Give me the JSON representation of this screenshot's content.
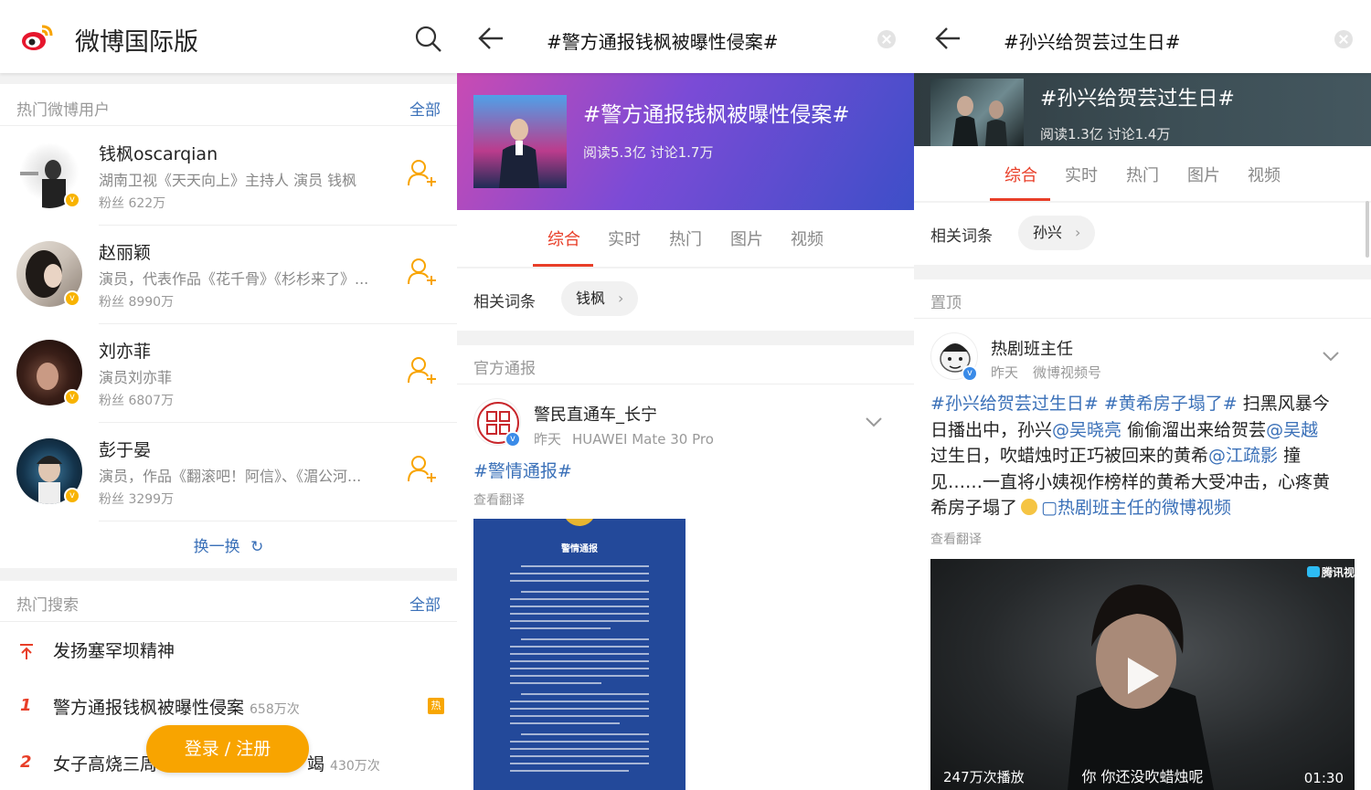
{
  "panel1": {
    "app_title": "微博国际版",
    "hot_users": {
      "label": "热门微博用户",
      "all": "全部",
      "users": [
        {
          "name": "钱枫oscarqian",
          "desc": "湖南卫视《天天向上》主持人 演员 钱枫",
          "fans": "粉丝 622万"
        },
        {
          "name": "赵丽颖",
          "desc": "演员，代表作品《花千骨》《杉杉来了》...",
          "fans": "粉丝 8990万"
        },
        {
          "name": "刘亦菲",
          "desc": "演员刘亦菲",
          "fans": "粉丝 6807万"
        },
        {
          "name": "彭于晏",
          "desc": "演员，作品《翻滚吧！阿信》、《湄公河...",
          "fans": "粉丝 3299万"
        }
      ],
      "refresh": "换一换"
    },
    "hot_search": {
      "label": "热门搜索",
      "all": "全部",
      "items": [
        {
          "rank": "",
          "text": "发扬塞罕坝精神",
          "count": "",
          "tag": ""
        },
        {
          "rank": "1",
          "text": "警方通报钱枫被曝性侵案",
          "count": "658万次",
          "tag": "热"
        },
        {
          "rank": "2",
          "text": "女子高烧三周",
          "count": "430万次",
          "tag": "",
          "tail": "竭"
        }
      ]
    },
    "login_button": "登录 / 注册"
  },
  "panel2": {
    "search_title": "#警方通报钱枫被曝性侵案#",
    "banner": {
      "title": "#警方通报钱枫被曝性侵案#",
      "meta": "阅读5.3亿  讨论1.7万"
    },
    "tabs": [
      "综合",
      "实时",
      "热门",
      "图片",
      "视频"
    ],
    "related": {
      "label": "相关词条",
      "chip": "钱枫"
    },
    "section_label": "官方通报",
    "post": {
      "name": "警民直通车_长宁",
      "time": "昨天",
      "device": "HUAWEI Mate 30 Pro",
      "hashtag": "#警情通报#",
      "translate": "查看翻译",
      "notice_title": "警情通报"
    }
  },
  "panel3": {
    "search_title": "#孙兴给贺芸过生日#",
    "banner": {
      "title": "#孙兴给贺芸过生日#",
      "meta": "阅读1.3亿  讨论1.4万"
    },
    "tabs": [
      "综合",
      "实时",
      "热门",
      "图片",
      "视频"
    ],
    "related": {
      "label": "相关词条",
      "chip": "孙兴"
    },
    "section_label": "置顶",
    "post": {
      "name": "热剧班主任",
      "time": "昨天",
      "source": "微博视频号",
      "tag1": "#孙兴给贺芸过生日#",
      "tag2": "#黄希房子塌了#",
      "t1": " 扫黑风暴今",
      "t2": "日播出中，孙兴",
      "m1": "@吴晓亮",
      "t3": " 偷偷溜出来给贺芸",
      "m2": "@吴越",
      "t4": "过生日，吹蜡烛时正巧被回来的黄希",
      "m3": "@江疏影",
      "t5": " 撞",
      "t6": "见……一直将小姨视作榜样的黄希大受冲击，心疼黄",
      "t7": "希房子塌了",
      "video_link": "热剧班主任的微博视频",
      "translate": "查看翻译",
      "video": {
        "plays": "247万次播放",
        "subtitle": "你 你还没吹蜡烛呢",
        "duration": "01:30",
        "brand": "腾讯视"
      }
    }
  },
  "colors": {
    "accent": "#e83e28",
    "link": "#3a70b8",
    "orange": "#f8a400"
  }
}
